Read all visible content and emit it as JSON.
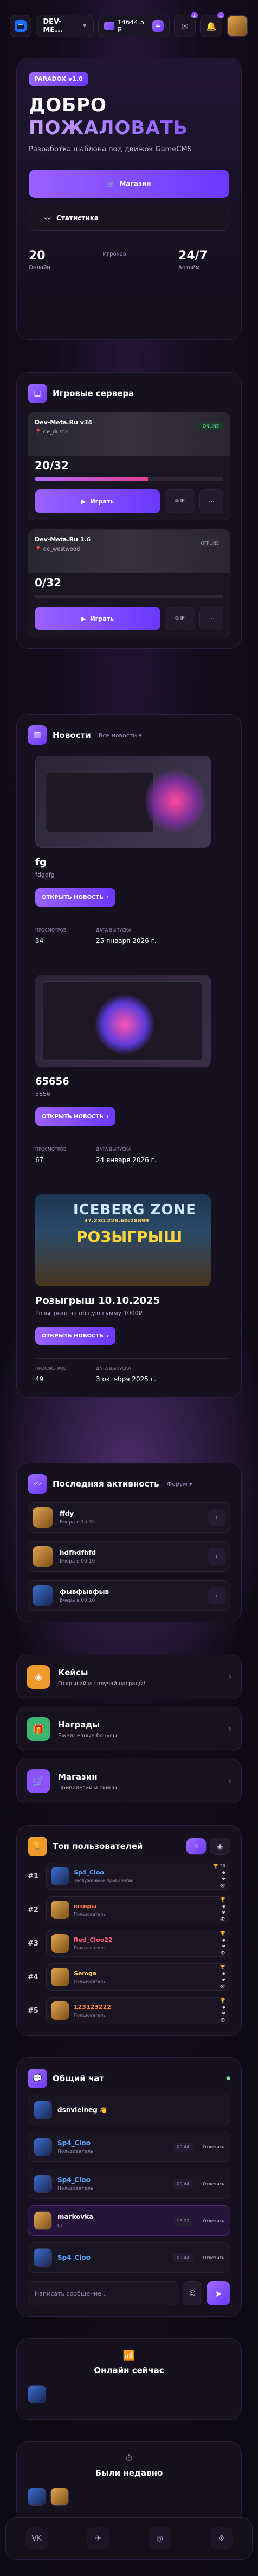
{
  "topbar": {
    "site_name": "DEV-ME...",
    "balance": "14644.5 ₽",
    "notif_count": "1",
    "messages_count": "1"
  },
  "hero": {
    "version_tag": "PARADOX v1.0",
    "title_line1": "ДОБРО",
    "title_line2": "ПОЖАЛОВАТЬ",
    "subtitle": "Разработка шаблона под движок GameCMS",
    "btn_shop": "Магазин",
    "btn_stats": "Статистика",
    "stats": [
      {
        "value": "20",
        "label": "Онлайн"
      },
      {
        "value": "",
        "label": "Игроков"
      },
      {
        "value": "24/7",
        "label": "Аптайм"
      }
    ]
  },
  "servers": {
    "title": "Игровые сервера",
    "items": [
      {
        "name": "Dev-Meta.Ru v34",
        "map": "de_dust2",
        "status": "ONLINE",
        "count": "20/32",
        "fill": 0.6
      },
      {
        "name": "Dev-Meta.Ru 1.6",
        "map": "de_westwood",
        "status": "OFFLINE",
        "count": "0/32",
        "fill": 0
      }
    ],
    "play_label": "Играть",
    "ip_label": "IP"
  },
  "news": {
    "title": "Новости",
    "all_link": "Все новости",
    "items": [
      {
        "title": "fg",
        "desc": "fdgdfg",
        "btn": "ОТКРЫТЬ НОВОСТЬ",
        "views_k": "ПРОСМОТРОВ",
        "views": "34",
        "date_k": "ДАТА ВЫПУСКА",
        "date": "25 января 2026 г."
      },
      {
        "title": "65656",
        "desc": "5656",
        "btn": "ОТКРЫТЬ НОВОСТЬ",
        "views_k": "ПРОСМОТРОВ",
        "views": "67",
        "date_k": "ДАТА ВЫПУСКА",
        "date": "24 января 2026 г."
      },
      {
        "title": "Розыгрыш 10.10.2025",
        "desc": "Розыгрыш на общую сумму 1000₽",
        "btn": "ОТКРЫТЬ НОВОСТЬ",
        "views_k": "ПРОСМОТРОВ",
        "views": "49",
        "date_k": "ДАТА ВЫПУСКА",
        "date": "3 октября 2025 г."
      }
    ],
    "banner3": {
      "line1": "ICEBERG ZONE",
      "line2": "37.230.228.60:28899",
      "line3": "РОЗЫГРЫШ"
    }
  },
  "activity": {
    "title": "Последняя активность",
    "tab": "Форум",
    "items": [
      {
        "name": "ffdy",
        "sub": "Вчера в 15:35"
      },
      {
        "name": "hdfhdfhfd",
        "sub": "Вчера в 00:16"
      },
      {
        "name": "фывфывфыв",
        "sub": "Вчера в 00:16"
      }
    ]
  },
  "tiles": [
    {
      "title": "Кейсы",
      "sub": "Открывай и получай награды!",
      "color": "#f09a2c"
    },
    {
      "title": "Награды",
      "sub": "Ежедневные бонусы",
      "color": "#3bb56f"
    },
    {
      "title": "Магазин",
      "sub": "Привилегии и скины",
      "color": "#8b52ff"
    }
  ],
  "top": {
    "title": "Топ пользователей",
    "rows": [
      {
        "rank": "#1",
        "name": "Sp4_Cloo",
        "sub": "Заслуженные привилегии",
        "r1": "20",
        "r2": "",
        "r3": "",
        "r4": "",
        "color": "#5aa6ff"
      },
      {
        "rank": "#2",
        "name": "юзеры",
        "sub": "Пользователь",
        "r1": "",
        "r2": "",
        "r3": "",
        "r4": "",
        "color": "#ff7a3c"
      },
      {
        "rank": "#3",
        "name": "Red_Cloo22",
        "sub": "Пользователь",
        "r1": "",
        "r2": "",
        "r3": "",
        "r4": "",
        "color": "#ff5a7a"
      },
      {
        "rank": "#4",
        "name": "Semga",
        "sub": "Пользователь",
        "r1": "",
        "r2": "",
        "r3": "",
        "r4": "",
        "color": "#ffcc44"
      },
      {
        "rank": "#5",
        "name": "123123222",
        "sub": "Пользователь",
        "r1": "",
        "r2": "",
        "r3": "",
        "r4": "",
        "color": "#ff8a3c"
      }
    ]
  },
  "chat": {
    "title": "Общий чат",
    "first_msg": "dsnvlelneg 👋",
    "messages": [
      {
        "name": "Sp4_Cloo",
        "text": "Пользователь",
        "time": "00:44",
        "reply": "Ответить"
      },
      {
        "name": "Sp4_Cloo",
        "text": "Пользователь",
        "time": "00:44",
        "reply": "Ответить"
      },
      {
        "name": "markovka",
        "text": "dj",
        "time": "18:22",
        "reply": "Ответить"
      },
      {
        "name": "Sp4_Cloo",
        "text": "",
        "time": "00:44",
        "reply": "Ответить"
      }
    ],
    "placeholder": "Написать сообщение..."
  },
  "online": {
    "title": "Онлайн сейчас"
  },
  "recent": {
    "title": "Были недавно"
  }
}
